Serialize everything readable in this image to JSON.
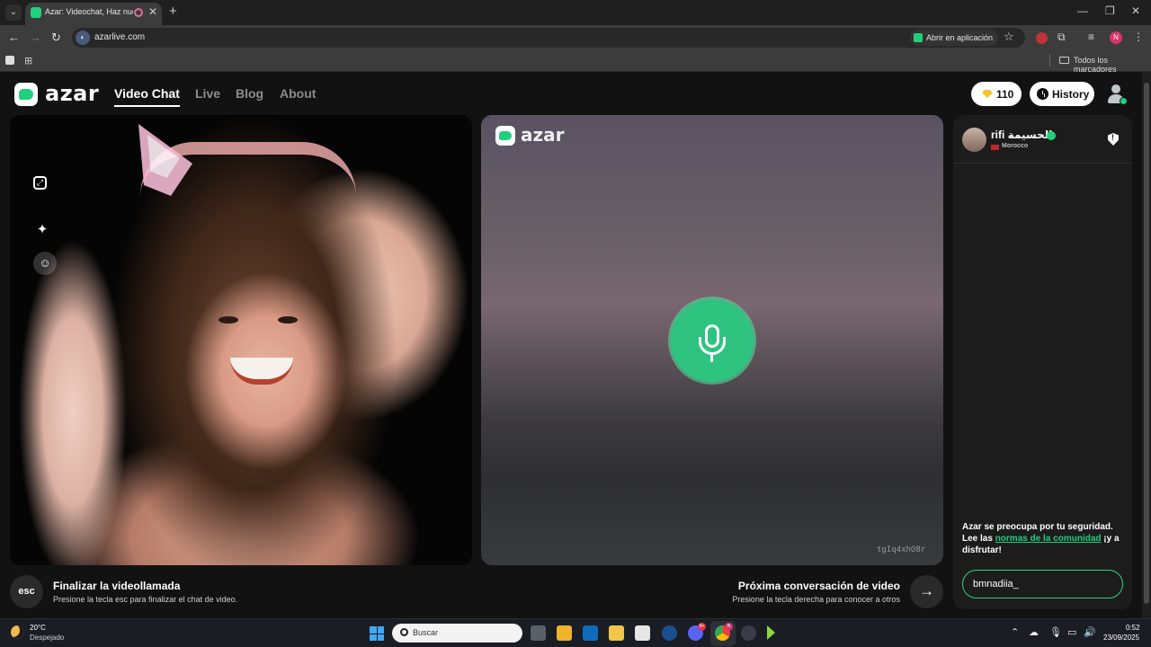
{
  "browser": {
    "tab_title": "Azar: Videochat, Haz nuevos amigos",
    "tab_close": "✕",
    "new_tab": "+",
    "url": "azarlive.com",
    "open_in_app": "Abrir en aplicación",
    "profile_initial": "N",
    "bookmarks_all": "Todos los marcadores"
  },
  "header": {
    "logo_text": "azar",
    "nav": [
      {
        "label": "Video Chat",
        "active": true
      },
      {
        "label": "Live"
      },
      {
        "label": "Blog"
      },
      {
        "label": "About"
      }
    ],
    "gems": "110",
    "history_label": "History"
  },
  "right_panel": {
    "logo_text": "azar",
    "session_id": "tgIq4xhO8r"
  },
  "chat": {
    "partner_name": "rifi الحسيمة",
    "partner_country": "Morocco",
    "safety_prefix": "Azar se preocupa por tu seguridad. Lee las ",
    "safety_link": "normas de la comunidad",
    "safety_suffix": " ¡y a disfrutar!",
    "input_value": "bmnadiia_"
  },
  "footer": {
    "esc_key": "esc",
    "end_title": "Finalizar la videollamada",
    "end_hint": "Presione la tecla esc para finalizar el chat de video.",
    "next_title": "Próxima conversación de video",
    "next_hint": "Presione la tecla derecha para conocer a otros",
    "next_arrow": "→"
  },
  "taskbar": {
    "temperature": "20°C",
    "weather": "Despejado",
    "search_placeholder": "Buscar",
    "discord_badge": "9+",
    "chrome_badge": "N",
    "time": "0:52",
    "date": "23/09/2025"
  },
  "colors": {
    "brand_green": "#1fd07c",
    "mic_green": "#2fc380",
    "gem_yellow": "#f7c52b"
  }
}
